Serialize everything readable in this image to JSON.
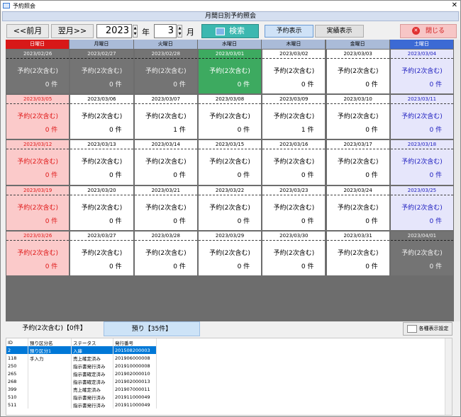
{
  "window": {
    "title": "予約照会",
    "close_glyph": "✕"
  },
  "subheader": "月間日別予約照会",
  "toolbar": {
    "prev": "<<前月",
    "next": "翌月>>",
    "year": "2023",
    "year_unit": "年",
    "month": "3",
    "month_unit": "月",
    "search": "検索",
    "view_reservation": "予約表示",
    "view_actual": "実績表示",
    "close": "閉じる"
  },
  "calendar": {
    "weekdays": [
      "日曜日",
      "月曜日",
      "火曜日",
      "水曜日",
      "木曜日",
      "金曜日",
      "土曜日"
    ],
    "weekday_colors": [
      "#d81818",
      "#aabbd8",
      "#aabbd8",
      "#aabbd8",
      "#aabbd8",
      "#aabbd8",
      "#3c6ad4"
    ],
    "weeks": [
      [
        {
          "date": "2023/02/26",
          "label": "予約(2次含む)",
          "count": "0 件",
          "style": "gray"
        },
        {
          "date": "2023/02/27",
          "label": "予約(2次含む)",
          "count": "0 件",
          "style": "gray"
        },
        {
          "date": "2023/02/28",
          "label": "予約(2次含む)",
          "count": "0 件",
          "style": "gray"
        },
        {
          "date": "2023/03/01",
          "label": "予約(2次含む)",
          "count": "0 件",
          "style": "green"
        },
        {
          "date": "2023/03/02",
          "label": "予約(2次含む)",
          "count": "0 件",
          "style": "white"
        },
        {
          "date": "2023/03/03",
          "label": "予約(2次含む)",
          "count": "0 件",
          "style": "white"
        },
        {
          "date": "2023/03/04",
          "label": "予約(2次含む)",
          "count": "0 件",
          "style": "sat"
        }
      ],
      [
        {
          "date": "2023/03/05",
          "label": "予約(2次含む)",
          "count": "0 件",
          "style": "sun"
        },
        {
          "date": "2023/03/06",
          "label": "予約(2次含む)",
          "count": "0 件",
          "style": "white"
        },
        {
          "date": "2023/03/07",
          "label": "予約(2次含む)",
          "count": "1 件",
          "style": "white"
        },
        {
          "date": "2023/03/08",
          "label": "予約(2次含む)",
          "count": "0 件",
          "style": "white"
        },
        {
          "date": "2023/03/09",
          "label": "予約(2次含む)",
          "count": "1 件",
          "style": "white"
        },
        {
          "date": "2023/03/10",
          "label": "予約(2次含む)",
          "count": "0 件",
          "style": "white"
        },
        {
          "date": "2023/03/11",
          "label": "予約(2次含む)",
          "count": "0 件",
          "style": "sat"
        }
      ],
      [
        {
          "date": "2023/03/12",
          "label": "予約(2次含む)",
          "count": "0 件",
          "style": "sun"
        },
        {
          "date": "2023/03/13",
          "label": "予約(2次含む)",
          "count": "0 件",
          "style": "white"
        },
        {
          "date": "2023/03/14",
          "label": "予約(2次含む)",
          "count": "0 件",
          "style": "white"
        },
        {
          "date": "2023/03/15",
          "label": "予約(2次含む)",
          "count": "0 件",
          "style": "white"
        },
        {
          "date": "2023/03/16",
          "label": "予約(2次含む)",
          "count": "0 件",
          "style": "white"
        },
        {
          "date": "2023/03/17",
          "label": "予約(2次含む)",
          "count": "0 件",
          "style": "white"
        },
        {
          "date": "2023/03/18",
          "label": "予約(2次含む)",
          "count": "0 件",
          "style": "sat"
        }
      ],
      [
        {
          "date": "2023/03/19",
          "label": "予約(2次含む)",
          "count": "0 件",
          "style": "sun"
        },
        {
          "date": "2023/03/20",
          "label": "予約(2次含む)",
          "count": "0 件",
          "style": "white"
        },
        {
          "date": "2023/03/21",
          "label": "予約(2次含む)",
          "count": "0 件",
          "style": "white"
        },
        {
          "date": "2023/03/22",
          "label": "予約(2次含む)",
          "count": "0 件",
          "style": "white"
        },
        {
          "date": "2023/03/23",
          "label": "予約(2次含む)",
          "count": "0 件",
          "style": "white"
        },
        {
          "date": "2023/03/24",
          "label": "予約(2次含む)",
          "count": "0 件",
          "style": "white"
        },
        {
          "date": "2023/03/25",
          "label": "予約(2次含む)",
          "count": "0 件",
          "style": "sat"
        }
      ],
      [
        {
          "date": "2023/03/26",
          "label": "予約(2次含む)",
          "count": "0 件",
          "style": "sun"
        },
        {
          "date": "2023/03/27",
          "label": "予約(2次含む)",
          "count": "0 件",
          "style": "white"
        },
        {
          "date": "2023/03/28",
          "label": "予約(2次含む)",
          "count": "0 件",
          "style": "white"
        },
        {
          "date": "2023/03/29",
          "label": "予約(2次含む)",
          "count": "0 件",
          "style": "white"
        },
        {
          "date": "2023/03/30",
          "label": "予約(2次含む)",
          "count": "0 件",
          "style": "white"
        },
        {
          "date": "2023/03/31",
          "label": "予約(2次含む)",
          "count": "0 件",
          "style": "white"
        },
        {
          "date": "2023/04/01",
          "label": "予約(2次含む)",
          "count": "0 件",
          "style": "gray"
        }
      ]
    ]
  },
  "tabs": {
    "tab1": "予約(2次含む)【0件】",
    "tab2": "預り【35件】",
    "settings": "各種表示設定"
  },
  "list": {
    "headers": [
      "ID",
      "預り区分名",
      "ステータス",
      "発行番号"
    ],
    "rows": [
      [
        "2",
        "預り区分1",
        "入庫",
        "201508200003"
      ],
      [
        "118",
        "手入力",
        "売上確定済み",
        "201906000008"
      ],
      [
        "250",
        "",
        "指示書発行済み",
        "201910000008"
      ],
      [
        "265",
        "",
        "指示書確定済み",
        "201902000010"
      ],
      [
        "268",
        "",
        "指示書確定済み",
        "201902000013"
      ],
      [
        "399",
        "",
        "売上確定済み",
        "201907000011"
      ],
      [
        "510",
        "",
        "指示書発行済み",
        "201911000049"
      ],
      [
        "511",
        "",
        "指示書発行済み",
        "201911000049"
      ]
    ]
  }
}
